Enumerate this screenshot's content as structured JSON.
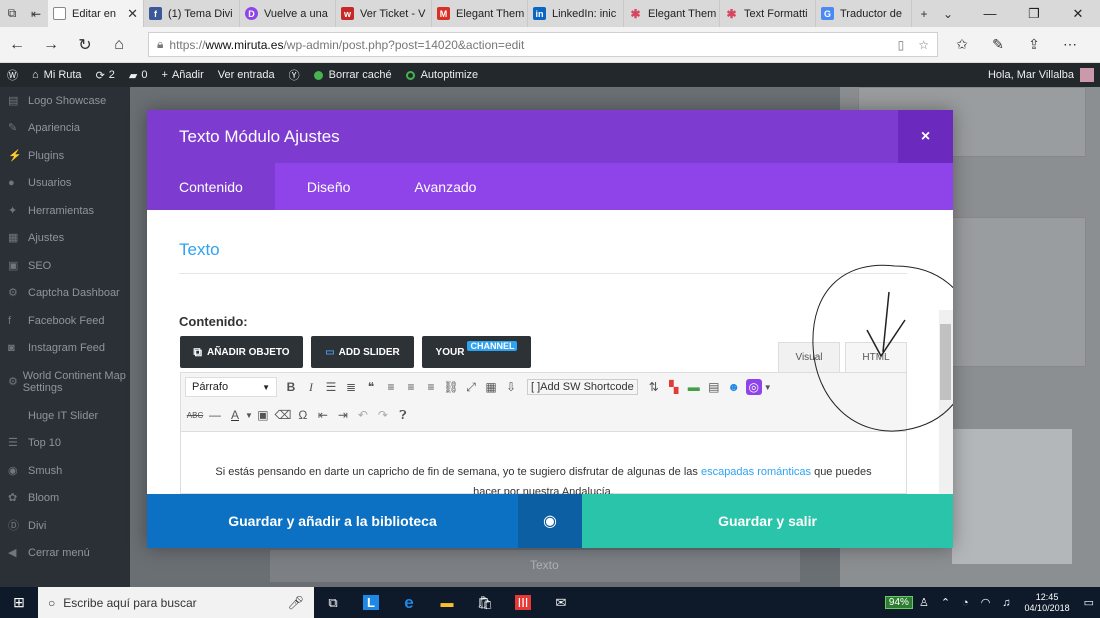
{
  "browser": {
    "tabs": [
      {
        "label": "Editar en",
        "icon": "doc-icon",
        "active": true
      },
      {
        "label": "(1) Tema Divi",
        "icon": "facebook-icon"
      },
      {
        "label": "Vuelve a una",
        "icon": "divi-icon"
      },
      {
        "label": "Ver Ticket - V",
        "icon": "ticket-icon"
      },
      {
        "label": "Elegant Them",
        "icon": "gmail-icon"
      },
      {
        "label": "LinkedIn: inic",
        "icon": "linkedin-icon"
      },
      {
        "label": "Elegant Them",
        "icon": "star-icon"
      },
      {
        "label": "Text Formatti",
        "icon": "star-icon"
      },
      {
        "label": "Traductor de",
        "icon": "translate-icon"
      }
    ],
    "url_prefix": "https://",
    "url_domain": "www.miruta.es",
    "url_path": "/wp-admin/post.php?post=14020&action=edit"
  },
  "wp_bar": {
    "site": "Mi Ruta",
    "updates": "2",
    "comments": "0",
    "add_new": "Añadir",
    "view_post": "Ver entrada",
    "clear_cache": "Borrar caché",
    "autoptimize": "Autoptimize",
    "greeting": "Hola, Mar Villalba"
  },
  "admin_sidebar": [
    "Logo Showcase",
    "Apariencia",
    "Plugins",
    "Usuarios",
    "Herramientas",
    "Ajustes",
    "SEO",
    "Captcha Dashboar",
    "Facebook Feed",
    "Instagram Feed",
    "World Continent Map Settings",
    "Huge IT Slider",
    "Top 10",
    "Smush",
    "Bloom",
    "Divi",
    "Cerrar menú"
  ],
  "modal": {
    "title": "Texto Módulo Ajustes",
    "close": "×",
    "tabs": [
      "Contenido",
      "Diseño",
      "Avanzado"
    ],
    "section_title": "Texto",
    "content_label": "Contenido:",
    "media_buttons": [
      "AÑADIR OBJETO",
      "ADD SLIDER",
      "YOUR"
    ],
    "channel_badge": "CHANNEL",
    "editor_tabs": [
      "Visual",
      "HTML"
    ],
    "format_select": "Párrafo",
    "shortcode_btn": "Add SW Shortcode",
    "editor_text_before": "Si estás pensando en darte un capricho de fin de semana, yo te sugiero disfrutar de algunas de las ",
    "editor_link": "escapadas románticas",
    "editor_text_after": " que puedes hacer por nuestra Andalucía.",
    "btn_library": "Guardar y añadir a la biblioteca",
    "btn_save": "Guardar y salir"
  },
  "background": {
    "bottom_label": "Texto"
  },
  "taskbar": {
    "search_placeholder": "Escribe aquí para buscar",
    "battery": "94%",
    "time": "12:45",
    "date": "04/10/2018"
  },
  "colors": {
    "modal_header": "#7e3bd0",
    "modal_tabs": "#8e44e8",
    "save_library": "#0c71c3",
    "save_exit": "#29c4a9",
    "link": "#2ea3f2"
  }
}
